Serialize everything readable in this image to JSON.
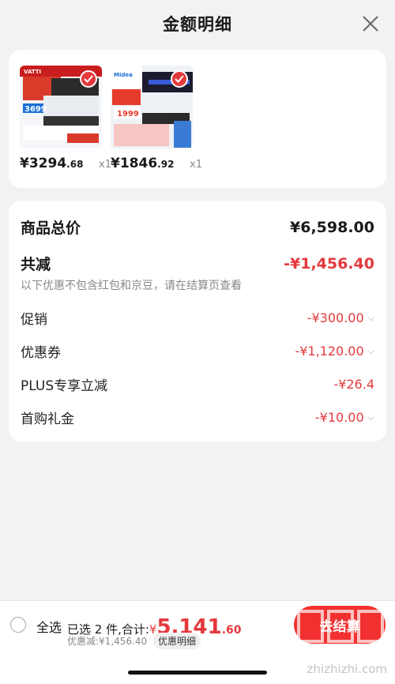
{
  "header": {
    "title": "金额明细"
  },
  "products": [
    {
      "price_int": "¥3294",
      "price_dec": ".68",
      "qty": "x1",
      "image_text": "3699",
      "brand": "VATTI"
    },
    {
      "price_int": "¥1846",
      "price_dec": ".92",
      "qty": "x1",
      "image_text": "1999",
      "brand": "Midea"
    }
  ],
  "details": {
    "total_label": "商品总价",
    "total_value": "¥6,598.00",
    "reduce_label": "共减",
    "reduce_value": "-¥1,456.40",
    "note": "以下优惠不包含红包和京豆，请在结算页查看",
    "items": [
      {
        "label": "促销",
        "value": "-¥300.00"
      },
      {
        "label": "优惠券",
        "value": "-¥1,120.00"
      },
      {
        "label": "PLUS专享立减",
        "value": "-¥26.4"
      },
      {
        "label": "首购礼金",
        "value": "-¥10.00"
      }
    ]
  },
  "bottom": {
    "select_all": "全选",
    "summary": "已选 2 件,合计:",
    "total_yen": "¥",
    "total_int": "5,141",
    "total_dec": ".60",
    "discount": "优惠减:¥1,456.40",
    "detail_btn": "优惠明细",
    "checkout": "去结算"
  },
  "watermark": {
    "site": "zhizhizhi.com"
  }
}
